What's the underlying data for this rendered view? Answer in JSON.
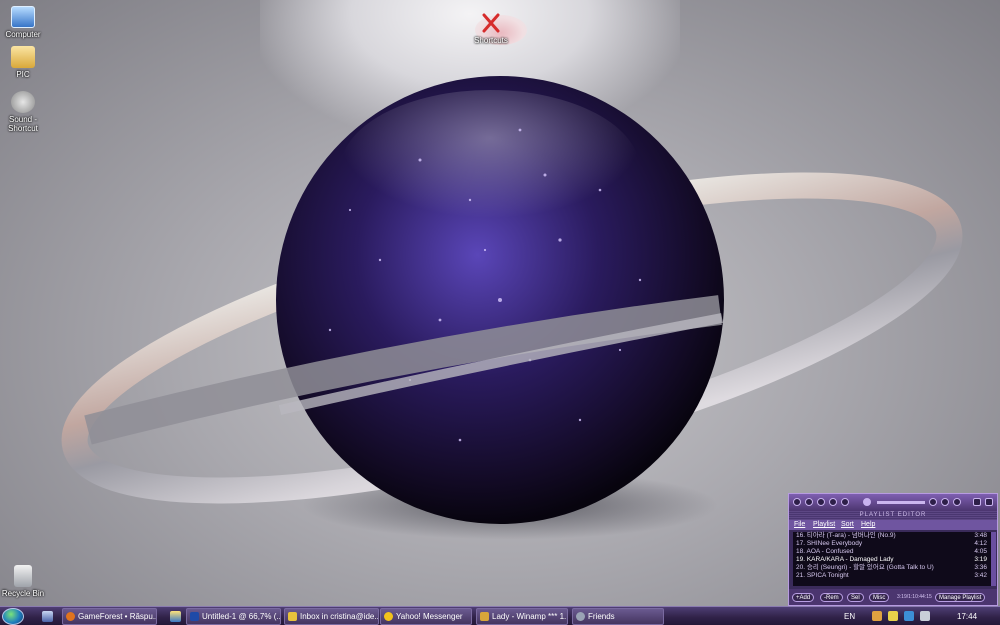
{
  "desktop": {
    "icons": [
      {
        "label": "Computer",
        "icon": "computer-icon"
      },
      {
        "label": "PIC",
        "icon": "folder-icon"
      },
      {
        "label": "Sound - Shortcut",
        "icon": "speaker-icon"
      },
      {
        "label": "Shortcuts",
        "icon": "shortcuts-icon"
      },
      {
        "label": "Recycle Bin",
        "icon": "recycle-bin-icon"
      }
    ]
  },
  "winamp": {
    "title": "PLAYLIST EDITOR",
    "menu": [
      "File",
      "Playlist",
      "Sort",
      "Help"
    ],
    "tracks": [
      {
        "title": "16. 티아라 (T-ara) - 넘버나인 (No.9)",
        "duration": "3:48"
      },
      {
        "title": "17. SHINee Everybody",
        "duration": "4:12"
      },
      {
        "title": "18. AOA - Confused",
        "duration": "4:05"
      },
      {
        "title": "19. KARA/KARA - Damaged Lady",
        "duration": "3:19"
      },
      {
        "title": "20. 승리 (Seungri) - 할말 있어요 (Gotta Talk to U)",
        "duration": "3:36"
      },
      {
        "title": "21. SPICA Tonight",
        "duration": "3:42"
      }
    ],
    "buttons": {
      "add": "+Add",
      "rem": "-Rem",
      "sel": "Sel",
      "misc": "Misc",
      "manage": "Manage Playlist"
    },
    "time": "3:19/1:10:44:15"
  },
  "taskbar": {
    "tasks": [
      {
        "label": "GameForest • Răspu...",
        "icon": "firefox-icon",
        "color": "#e0731e"
      },
      {
        "label": "Untitled-1 @ 66,7% (...",
        "icon": "photoshop-icon",
        "color": "#1f4aa8"
      },
      {
        "label": "Inbox in cristina@ide...",
        "icon": "mail-icon",
        "color": "#e8c23c"
      },
      {
        "label": "Yahoo! Messenger",
        "icon": "yahoo-messenger-icon",
        "color": "#f2c21b"
      },
      {
        "label": "Lady - Winamp *** 1...",
        "icon": "winamp-icon",
        "color": "#d8a63a"
      },
      {
        "label": "Friends",
        "icon": "steam-icon",
        "color": "#9aa3b5"
      }
    ],
    "language": "EN",
    "clock": "17:44"
  },
  "colors": {
    "taskbar": "#2f2147",
    "winamp_frame": "#7e5fb1",
    "planet": "#2a1b5e"
  }
}
